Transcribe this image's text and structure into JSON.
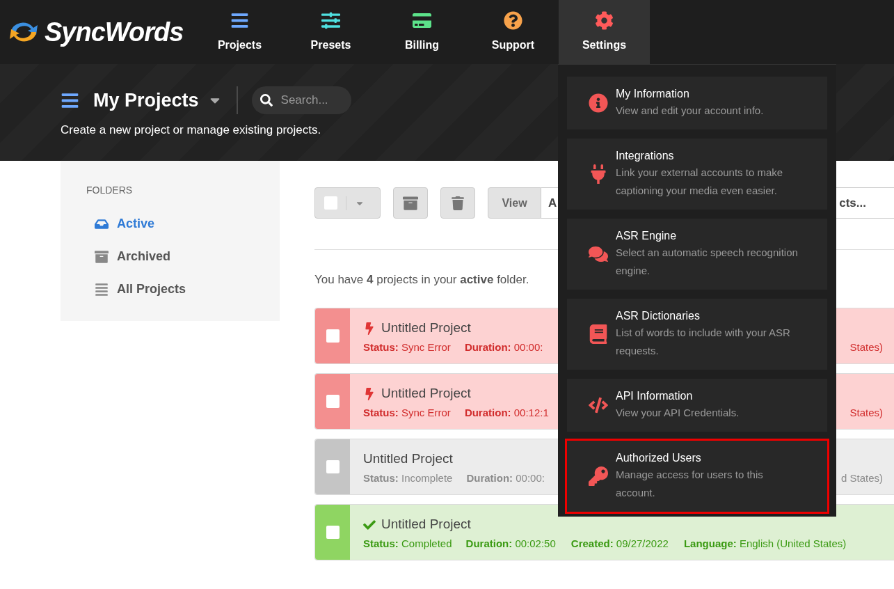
{
  "brand": {
    "name": "SyncWords"
  },
  "nav": [
    {
      "label": "Projects",
      "kind": "projects",
      "selected": false
    },
    {
      "label": "Presets",
      "kind": "presets",
      "selected": false
    },
    {
      "label": "Billing",
      "kind": "billing",
      "selected": false
    },
    {
      "label": "Support",
      "kind": "support",
      "selected": false
    },
    {
      "label": "Settings",
      "kind": "settings",
      "selected": true
    }
  ],
  "header": {
    "title": "My Projects",
    "search": {
      "placeholder": "Search..."
    },
    "subtitle": "Create a new project or manage existing projects."
  },
  "sidebar": {
    "heading": "FOLDERS",
    "items": [
      {
        "label": "Active",
        "kind": "active",
        "selected": true
      },
      {
        "label": "Archived",
        "kind": "archived",
        "selected": false
      },
      {
        "label": "All Projects",
        "kind": "all",
        "selected": false
      }
    ]
  },
  "toolbar": {
    "select_all_checked": false,
    "view_button": "View",
    "view_value_start": "A",
    "view_value_end": "cts..."
  },
  "summary": "You have **4** projects in your **active** folder.",
  "projects": [
    {
      "kind": "error",
      "checked": false,
      "title": "Untitled Project",
      "status_label": "Status:",
      "status": "Sync Error",
      "duration_label": "Duration:",
      "duration": "00:00:",
      "tail": "States)"
    },
    {
      "kind": "error",
      "checked": false,
      "title": "Untitled Project",
      "status_label": "Status:",
      "status": "Sync Error",
      "duration_label": "Duration:",
      "duration": "00:12:1",
      "tail": "States)"
    },
    {
      "kind": "incomplete",
      "checked": false,
      "title": "Untitled Project",
      "status_label": "Status:",
      "status": "Incomplete",
      "duration_label": "Duration:",
      "duration": "00:00:",
      "tail": "d States)"
    },
    {
      "kind": "completed",
      "checked": false,
      "title": "Untitled Project",
      "status_label": "Status:",
      "status": "Completed",
      "duration_label": "Duration:",
      "duration": "00:02:50",
      "created_label": "Created:",
      "created": "09/27/2022",
      "language_label": "Language:",
      "language": "English (United States)"
    }
  ],
  "settings_menu": [
    {
      "kind": "info",
      "title": "My Information",
      "description": "View and edit your account info.",
      "highlighted": false
    },
    {
      "kind": "integrations",
      "title": "Integrations",
      "description": "Link your external accounts to make captioning your media even easier.",
      "highlighted": false
    },
    {
      "kind": "asr",
      "title": "ASR Engine",
      "description": "Select an automatic speech recognition engine.",
      "highlighted": false
    },
    {
      "kind": "dictionaries",
      "title": "ASR Dictionaries",
      "description": "List of words to include with your ASR requests.",
      "highlighted": false
    },
    {
      "kind": "api",
      "title": "API Information",
      "description": "View your API Credentials.",
      "highlighted": false
    },
    {
      "kind": "users",
      "title": "Authorized Users",
      "description": "Manage access for users to this account.",
      "highlighted": true
    }
  ]
}
